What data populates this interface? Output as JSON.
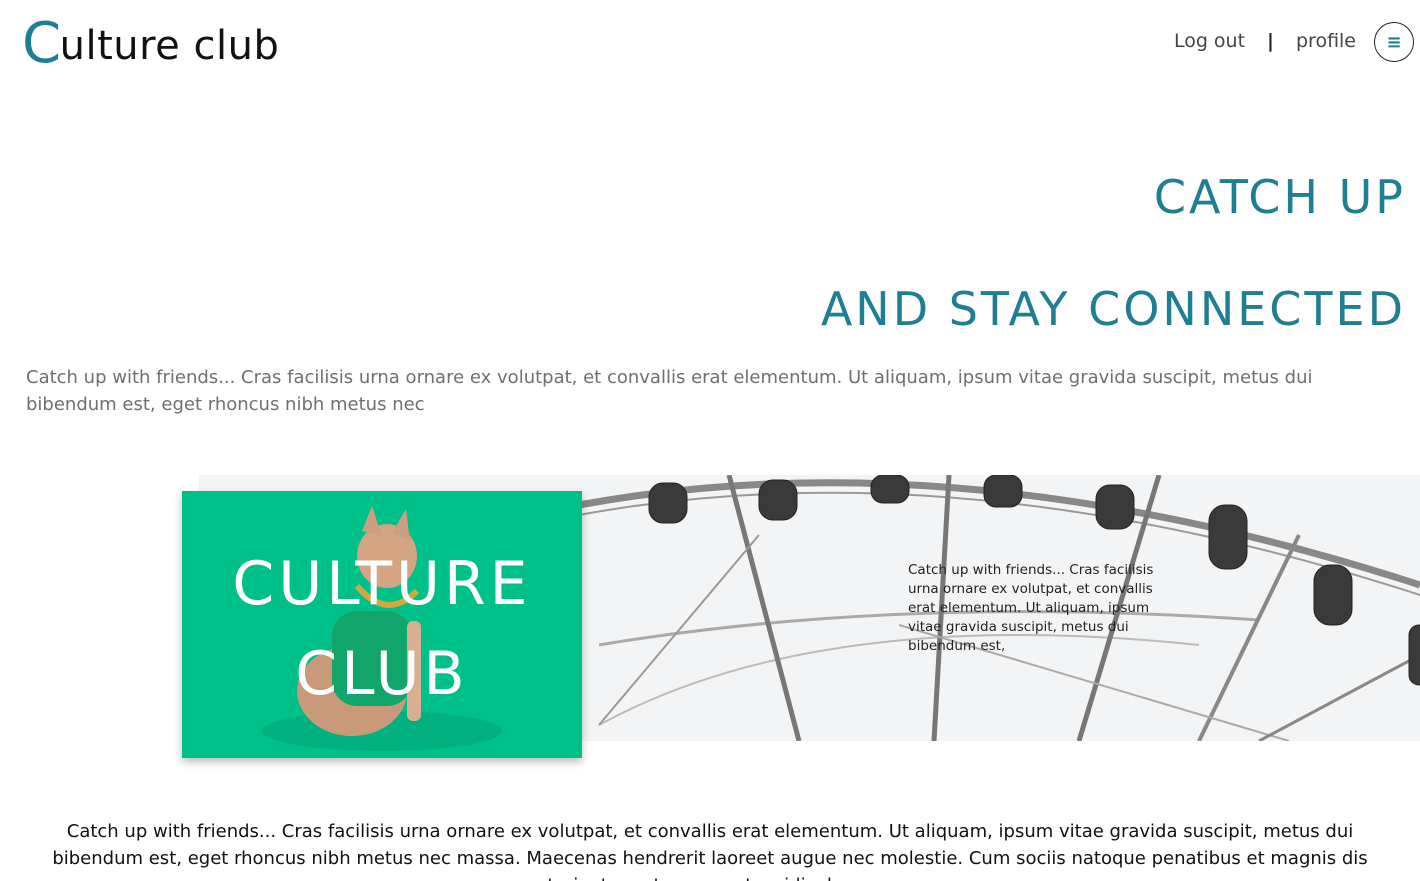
{
  "header": {
    "logo_initial": "C",
    "logo_rest": "ulture club",
    "logout_label": "Log out",
    "separator": "|",
    "profile_label": "profile",
    "menu_glyph": "≡"
  },
  "hero": {
    "line1": "CATCH UP",
    "line2": "AND STAY CONNECTED",
    "intro": "Catch up with friends... Cras facilisis urna ornare ex volutpat, et convallis erat elementum. Ut aliquam, ipsum vitae gravida suscipit, metus dui bibendum est, eget rhoncus nibh metus nec"
  },
  "banner": {
    "card_title": "CULTURE\nCLUB",
    "side_text": "Catch up with friends... Cras facilisis urna ornare ex volutpat, et convallis erat elementum. Ut aliquam, ipsum vitae gravida suscipit, metus dui bibendum est,"
  },
  "footer_text": "Catch up with friends... Cras facilisis urna ornare ex volutpat, et convallis erat elementum. Ut aliquam, ipsum vitae gravida suscipit, metus dui bibendum est, eget rhoncus nibh metus nec massa. Maecenas hendrerit laoreet augue nec molestie. Cum sociis natoque penatibus et magnis dis parturient montes, nascetur ridiculus mus.",
  "colors": {
    "accent": "#1e7f93",
    "card_green": "#00c08a",
    "banner_bg": "#f2f4f6"
  },
  "icons": [
    "hamburger-menu-icon",
    "ferris-wheel-image",
    "dog-photo-image"
  ]
}
